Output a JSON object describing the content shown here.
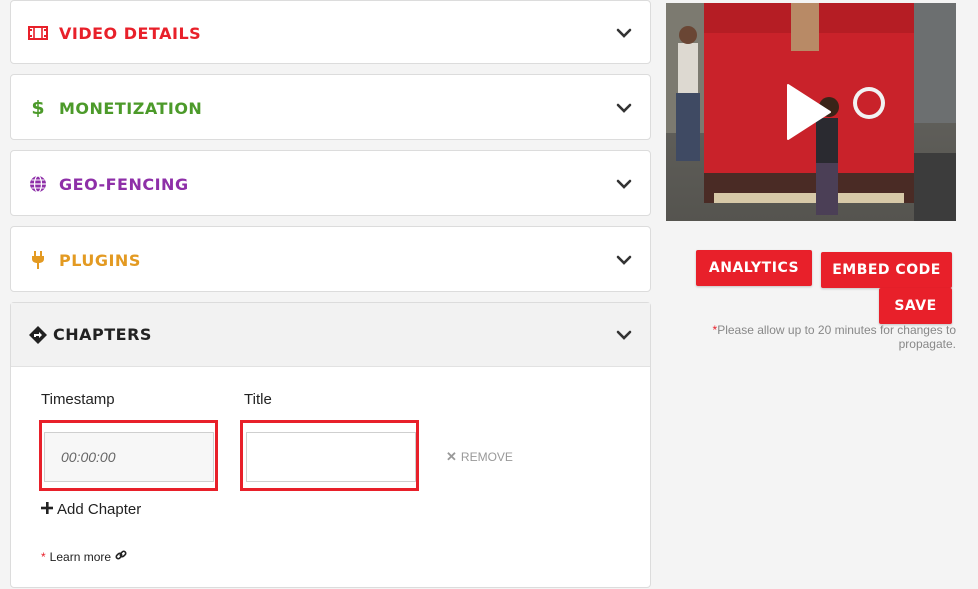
{
  "panels": {
    "video_details": {
      "label": "VIDEO DETAILS",
      "color": "#e8202a",
      "icon": "film-icon"
    },
    "monetization": {
      "label": "MONETIZATION",
      "color": "#4c9a2a",
      "icon": "dollar-icon"
    },
    "geo_fencing": {
      "label": "GEO-FENCING",
      "color": "#8e2fa8",
      "icon": "globe-icon"
    },
    "plugins": {
      "label": "PLUGINS",
      "color": "#e39a22",
      "icon": "plug-icon"
    },
    "chapters": {
      "label": "CHAPTERS",
      "color": "#222222",
      "icon": "directions-sign-icon"
    }
  },
  "chapters": {
    "timestamp_label": "Timestamp",
    "title_label": "Title",
    "timestamp_placeholder": "00:00:00",
    "title_value": "",
    "remove_label": "REMOVE",
    "add_label": "Add Chapter",
    "learn_star": "*",
    "learn_label": "Learn more"
  },
  "actions": {
    "analytics": "ANALYTICS",
    "embed": "EMBED CODE",
    "save": "SAVE"
  },
  "note": {
    "star": "*",
    "text": "Please allow up to 20 minutes for changes to propagate."
  },
  "colors": {
    "accent": "#e8202a"
  }
}
